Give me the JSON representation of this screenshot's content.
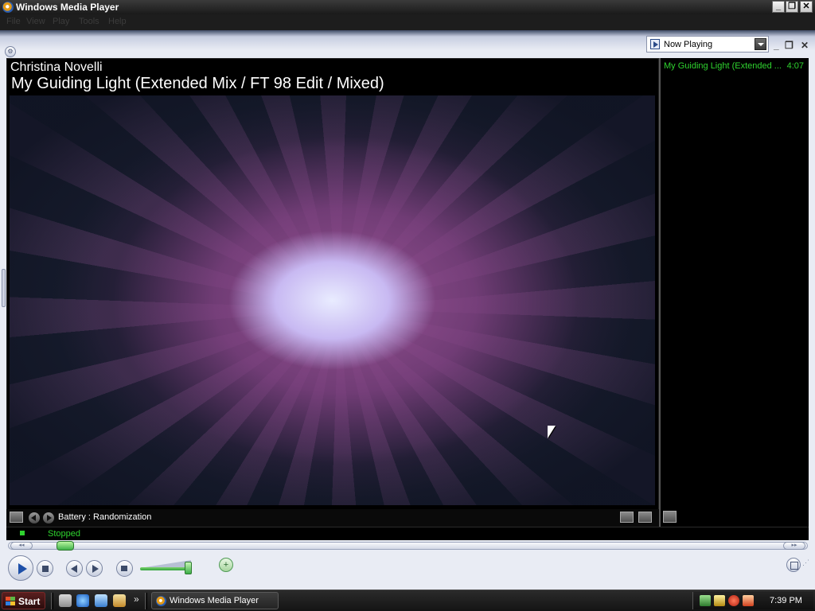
{
  "window": {
    "title": "Windows Media Player",
    "controls": {
      "minimize": "_",
      "restore": "❐",
      "close": "✕"
    }
  },
  "menu": [
    "File",
    "View",
    "Play",
    "Tools",
    "Help"
  ],
  "now_playing": {
    "selector_label": "Now Playing",
    "artist": "Christina Novelli",
    "song_title": "My Guiding Light (Extended Mix / FT 98 Edit / Mixed)",
    "visualization": "Battery : Randomization"
  },
  "playlist": {
    "items": [
      {
        "title": "My Guiding Light (Extended ...",
        "duration": "4:07"
      }
    ]
  },
  "status": {
    "text": "Stopped"
  },
  "transport": {
    "seek_position": 0.03,
    "volume_level": 0.95
  },
  "taskbar": {
    "start_label": "Start",
    "quicklaunch_more": "»",
    "task_item": "Windows Media Player",
    "clock": "7:39 PM"
  },
  "colors": {
    "status_green": "#2fd32f",
    "chrome": "#e9ecf4",
    "visualization_purple": "#9c5498"
  }
}
